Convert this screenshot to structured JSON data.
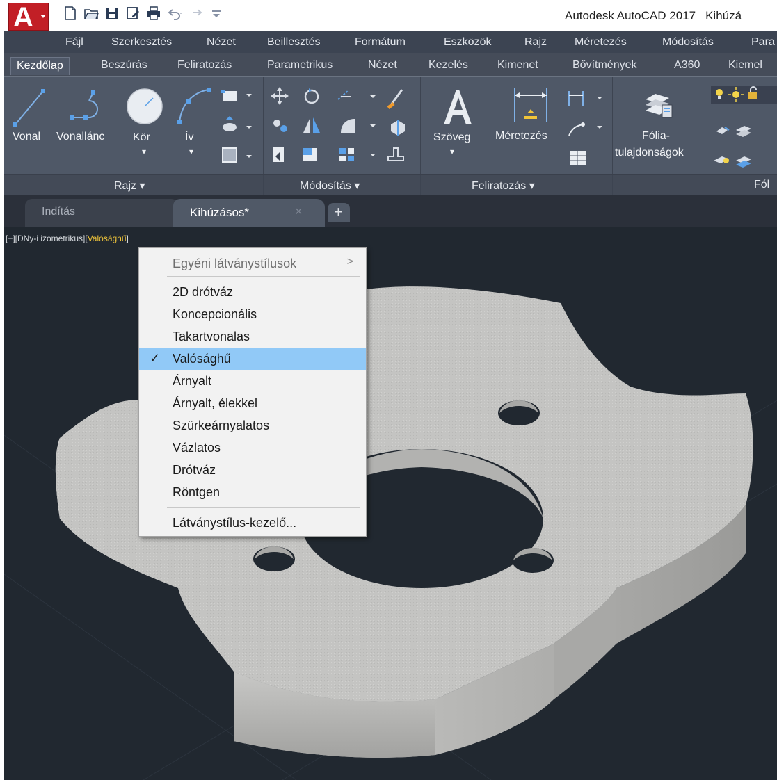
{
  "titlebar": {
    "app_letter": "A",
    "app_name": "Autodesk AutoCAD 2017",
    "file_name": "Kihúzá"
  },
  "menubar": {
    "items": [
      "Fájl",
      "Szerkesztés",
      "Nézet",
      "Beillesztés",
      "Formátum",
      "Eszközök",
      "Rajz",
      "Méretezés",
      "Módosítás",
      "Para"
    ]
  },
  "ribbon": {
    "tabs": [
      "Kezdőlap",
      "Beszúrás",
      "Feliratozás",
      "Parametrikus",
      "Nézet",
      "Kezelés",
      "Kimenet",
      "Bővítmények",
      "A360",
      "Kiemel"
    ],
    "active_tab": "Kezdőlap",
    "tools": {
      "line": "Vonal",
      "polyline": "Vonallánc",
      "circle": "Kör",
      "arc": "Ív",
      "text": "Szöveg",
      "dimension": "Méretezés",
      "layer_props_1": "Fólia-",
      "layer_props_2": "tulajdonságok"
    },
    "panels": [
      "Rajz",
      "Módosítás",
      "Feliratozás",
      "Fól"
    ],
    "panel_arrow": "▾"
  },
  "filetabs": {
    "start": "Indítás",
    "current": "Kihúzásos*",
    "close": "×",
    "new": "+"
  },
  "viewport": {
    "label_prefix": "[−][DNy-i izometrikus][",
    "visual_style": "Valósághű",
    "label_suffix": "]",
    "background": "#212830"
  },
  "context_menu": {
    "header": "Egyéni látványstílusok",
    "header_arrow": ">",
    "items": [
      "2D drótváz",
      "Koncepcionális",
      "Takartvonalas",
      "Valósághű",
      "Árnyalt",
      "Árnyalt, élekkel",
      "Szürkeárnyalatos",
      "Vázlatos",
      "Drótváz",
      "Röntgen"
    ],
    "selected_index": 3,
    "check": "✓",
    "footer": "Látványstílus-kezelő...",
    "selected_color": "#91c9f7"
  },
  "colors": {
    "brand_red": "#c21f26",
    "menubar_bg": "#3c4452",
    "ribbon_bg": "#4f5867",
    "label_highlight": "#f0c53a"
  }
}
